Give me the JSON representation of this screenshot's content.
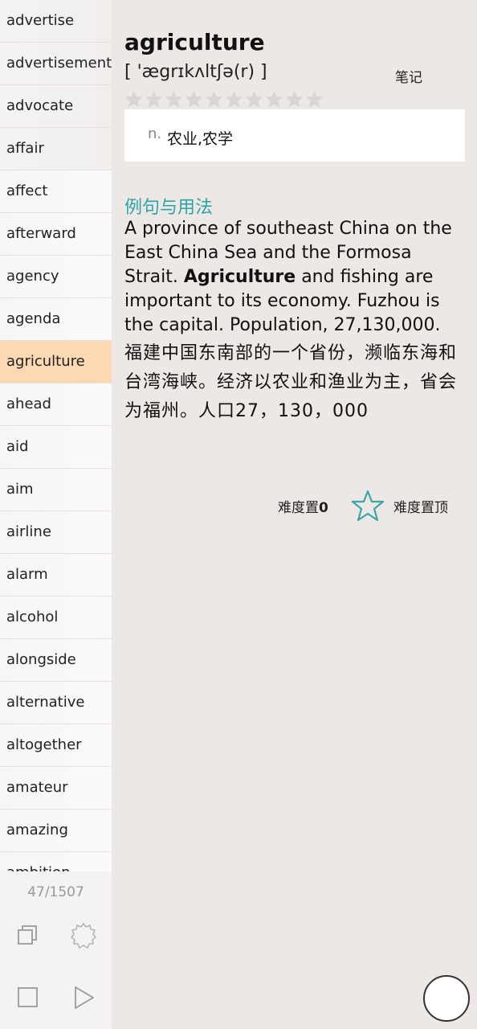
{
  "sidebar": {
    "items": [
      {
        "label": "advertise"
      },
      {
        "label": "advertisement"
      },
      {
        "label": "advocate"
      },
      {
        "label": "affair"
      },
      {
        "label": "affect"
      },
      {
        "label": "afterward"
      },
      {
        "label": "agency"
      },
      {
        "label": "agenda"
      },
      {
        "label": "agriculture",
        "selected": true
      },
      {
        "label": "ahead"
      },
      {
        "label": "aid"
      },
      {
        "label": "aim"
      },
      {
        "label": "airline"
      },
      {
        "label": "alarm"
      },
      {
        "label": "alcohol"
      },
      {
        "label": "alongside"
      },
      {
        "label": "alternative"
      },
      {
        "label": "altogether"
      },
      {
        "label": "amateur"
      },
      {
        "label": "amazing"
      },
      {
        "label": "ambition"
      }
    ],
    "counter": "47/1507",
    "buttons": {
      "copy": "copy-icon",
      "settings": "gear-icon",
      "stop": "stop-icon",
      "play": "play-icon"
    }
  },
  "entry": {
    "headword": "agriculture",
    "phonetic": "[ 'ægrɪkʌltʃə(r) ]",
    "note_label": "笔记",
    "rating": {
      "filled": 0,
      "total": 10
    },
    "definition": {
      "pos": "n.",
      "text": "农业,农学"
    }
  },
  "examples": {
    "title": "例句与用法",
    "en_before": "A province of southeast China on the East China Sea and the Formosa Strait. ",
    "en_bold": "Agriculture",
    "en_after": " and fishing are important to its economy. Fuzhou is the capital. Population, 27,130,000.",
    "zh": "福建中国东南部的一个省份，濒临东海和台湾海峡。经济以农业和渔业为主，省会为福州。人口27，130，000"
  },
  "difficulty": {
    "label": "难度置",
    "value": "0",
    "top_label": "难度置顶"
  },
  "colors": {
    "accent": "#2ba6a6",
    "selected_row": "#fcd8b3",
    "background": "#ede7e6"
  }
}
